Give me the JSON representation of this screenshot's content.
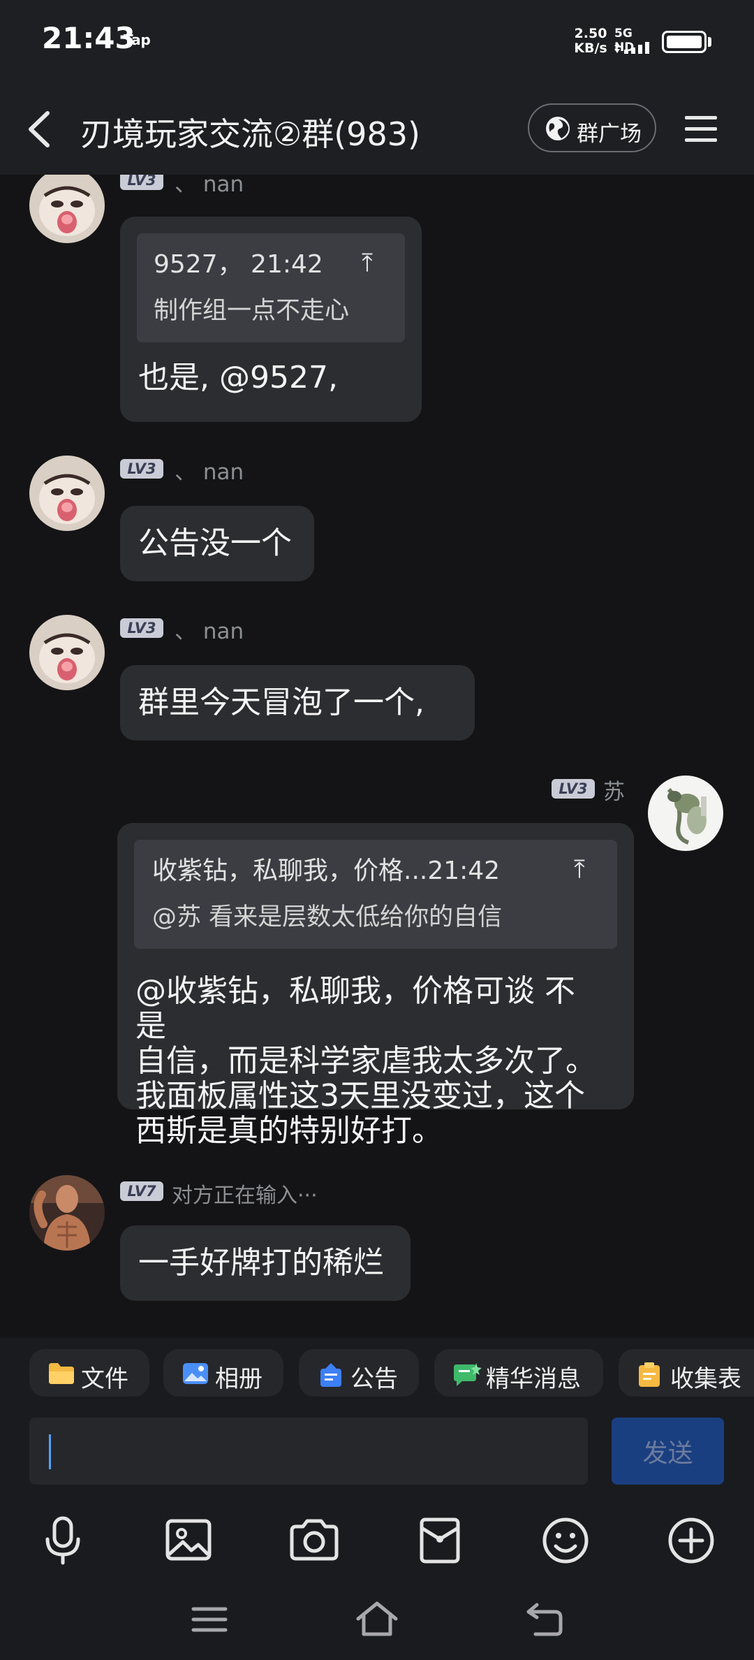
{
  "status_bar": {
    "time": "21:43",
    "app_hint": "Tap",
    "speed_value": "2.50",
    "speed_unit": "KB/s",
    "network": "5G HD",
    "battery_level": 1.0
  },
  "header": {
    "title": "刃境玩家交流②群(983)",
    "plaza_label": "群广场"
  },
  "messages": [
    {
      "level": "LV3",
      "sender": "、 nan",
      "quote_meta": "9527， 21:42",
      "quote_body": "制作组一点不走心",
      "quote_arrow": "↑",
      "text": "也是, @9527,"
    },
    {
      "level": "LV3",
      "sender": "、 nan",
      "text": "公告没一个"
    },
    {
      "level": "LV3",
      "sender": "、 nan",
      "text": "群里今天冒泡了一个,"
    },
    {
      "level": "LV3",
      "sender": "苏",
      "quote_meta": "收紫钻，私聊我，价格...21:42",
      "quote_body": "@苏 看来是层数太低给你的自信",
      "quote_arrow": "↑",
      "text": "@收紫钻，私聊我，价格可谈 不是\n自信，而是科学家虐我太多次了。\n我面板属性这3天里没变过，这个\n西斯是真的特别好打。"
    },
    {
      "level": "LV7",
      "sender": "对方正在输入···",
      "text": "一手好牌打的稀烂"
    }
  ],
  "shortcuts": [
    {
      "label": "文件",
      "icon": "folder-icon",
      "color": "#f5b942"
    },
    {
      "label": "相册",
      "icon": "album-icon",
      "color": "#4a8ff7"
    },
    {
      "label": "公告",
      "icon": "announcement-icon",
      "color": "#3d7ff5"
    },
    {
      "label": "精华消息",
      "icon": "highlight-message-icon",
      "color": "#3fb96a"
    },
    {
      "label": "收集表",
      "icon": "clipboard-icon",
      "color": "#f5b942"
    }
  ],
  "composer": {
    "input_value": "",
    "send_label": "发送"
  },
  "toolbar_icons": [
    "microphone-icon",
    "image-icon",
    "camera-icon",
    "red-packet-icon",
    "emoji-icon",
    "plus-icon"
  ],
  "nav_icons": [
    "recent-apps-icon",
    "home-icon",
    "back-nav-icon"
  ],
  "colors": {
    "background": "#141416",
    "bubble": "#2c2d31",
    "accent": "#4fa3ff",
    "send_button": "#1a3f80"
  }
}
